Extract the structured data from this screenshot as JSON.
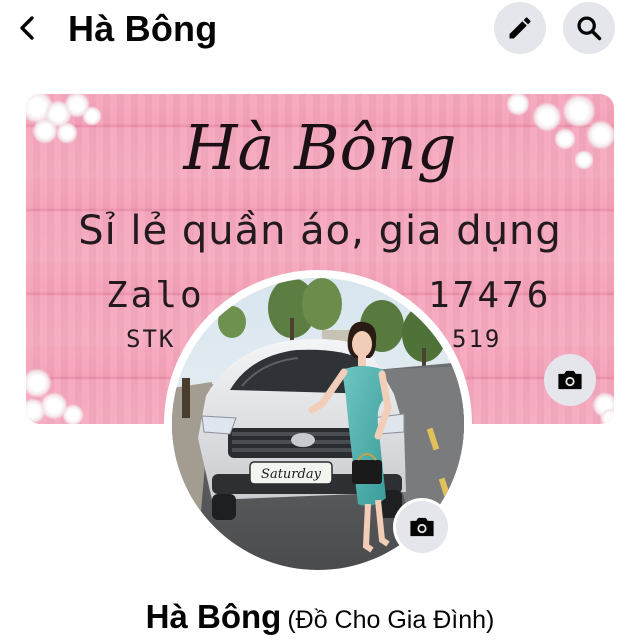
{
  "header": {
    "title": "Hà Bông",
    "back_icon": "chevron-left-icon",
    "edit_icon": "pencil-icon",
    "search_icon": "search-icon"
  },
  "cover": {
    "title": "Hà Bông",
    "subtitle": "Sỉ lẻ quần áo, gia dụng",
    "zalo_label": "Zalo",
    "zalo_visible_digits": "17476",
    "stk_label": "STK",
    "stk_visible_digits": "519",
    "camera_icon": "camera-icon",
    "background_color": "#f6a8bd"
  },
  "avatar": {
    "plate_text": "Saturday",
    "camera_icon": "camera-icon"
  },
  "profile": {
    "name": "Hà Bông",
    "alternate_name": "(Đồ Cho Gia Đình)"
  },
  "colors": {
    "button_bg": "#e4e6eb",
    "text": "#050505"
  }
}
